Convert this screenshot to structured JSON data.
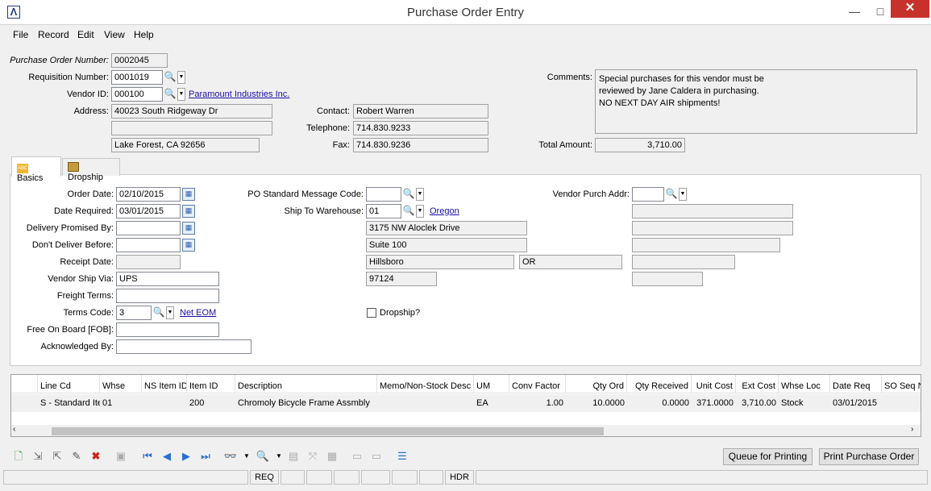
{
  "window": {
    "title": "Purchase Order Entry",
    "app_logo": "Λ",
    "min_icon": "—",
    "max_icon": "□",
    "close_icon": "✕"
  },
  "menu": [
    "File",
    "Record",
    "Edit",
    "View",
    "Help"
  ],
  "header": {
    "po_number_label": "Purchase Order Number:",
    "po_number": "0002045",
    "requisition_label": "Requisition Number:",
    "requisition": "0001019",
    "vendor_label": "Vendor ID:",
    "vendor_id": "000100",
    "vendor_name": "Paramount Industries Inc.",
    "address_label": "Address:",
    "address1": "40023 South Ridgeway Dr",
    "address2": "",
    "address3": "Lake Forest, CA  92656",
    "contact_label": "Contact:",
    "contact": "Robert Warren",
    "telephone_label": "Telephone:",
    "telephone": "714.830.9233",
    "fax_label": "Fax:",
    "fax": "714.830.9236",
    "comments_label": "Comments:",
    "comments": [
      "Special purchases for this vendor must be",
      "reviewed by Jane Caldera in purchasing.",
      "NO NEXT DAY AIR shipments!"
    ],
    "total_label": "Total Amount:",
    "total": "3,710.00"
  },
  "tabs": [
    {
      "label": "Basics",
      "icon": "ABC"
    },
    {
      "label": "Dropship",
      "icon": "truck"
    }
  ],
  "basics": {
    "order_date_label": "Order Date:",
    "order_date": "02/10/2015",
    "date_required_label": "Date Required:",
    "date_required": "03/01/2015",
    "delivery_promised_label": "Delivery Promised By:",
    "delivery_promised": "",
    "dont_deliver_label": "Don't Deliver Before:",
    "dont_deliver": "",
    "receipt_date_label": "Receipt Date:",
    "receipt_date": "",
    "ship_via_label": "Vendor Ship Via:",
    "ship_via": "UPS",
    "freight_label": "Freight Terms:",
    "freight": "",
    "terms_label": "Terms Code:",
    "terms_code": "3",
    "terms_desc": "Net EOM",
    "fob_label": "Free On Board [FOB]:",
    "fob": "",
    "ack_label": "Acknowledged By:",
    "ack": "",
    "po_msg_label": "PO Standard Message Code:",
    "po_msg": "",
    "ship_to_label": "Ship To Warehouse:",
    "ship_to": "01",
    "ship_to_name": "Oregon",
    "wh_addr1": "3175 NW Aloclek Drive",
    "wh_addr2": "Suite 100",
    "wh_city": "Hillsboro",
    "wh_state": "OR",
    "wh_zip": "97124",
    "dropship_label": "Dropship?",
    "vendor_purch_label": "Vendor Purch Addr:",
    "vendor_purch": ""
  },
  "grid": {
    "columns": [
      "Line Cd",
      "Whse",
      "NS Item ID",
      "Item ID",
      "Description",
      "Memo/Non-Stock Desc",
      "UM",
      "Conv Factor",
      "Qty Ord",
      "Qty Received",
      "Unit Cost",
      "Ext Cost",
      "Whse Loc",
      "Date Req",
      "SO Seq N"
    ],
    "rows": [
      [
        "S - Standard Ite",
        "01",
        "",
        "200",
        "Chromoly Bicycle Frame Assmbly",
        "",
        "EA",
        "1.00",
        "10.0000",
        "0.0000",
        "371.0000",
        "3,710.00",
        "Stock",
        "03/01/2015",
        ""
      ]
    ]
  },
  "buttons": {
    "queue": "Queue for Printing",
    "print": "Print Purchase Order"
  },
  "status": {
    "req": "REQ",
    "hdr": "HDR"
  }
}
